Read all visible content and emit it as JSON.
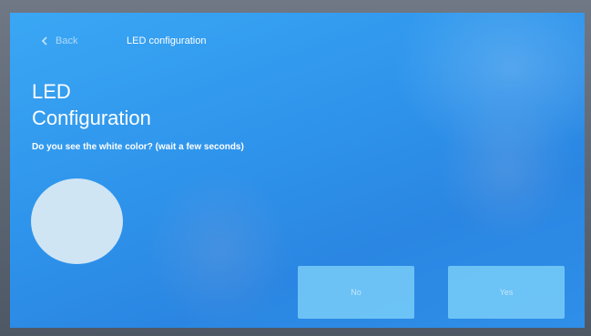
{
  "header": {
    "back_label": "Back",
    "title": "LED configuration"
  },
  "main": {
    "title_line1": "LED",
    "title_line2": "Configuration",
    "prompt": "Do you see the white color? (wait a few seconds)",
    "test_color": "#cfe5f4",
    "buttons": {
      "no_label": "No",
      "yes_label": "Yes"
    }
  },
  "colors": {
    "background": "#2f95ec",
    "button": "#78cdf8"
  }
}
